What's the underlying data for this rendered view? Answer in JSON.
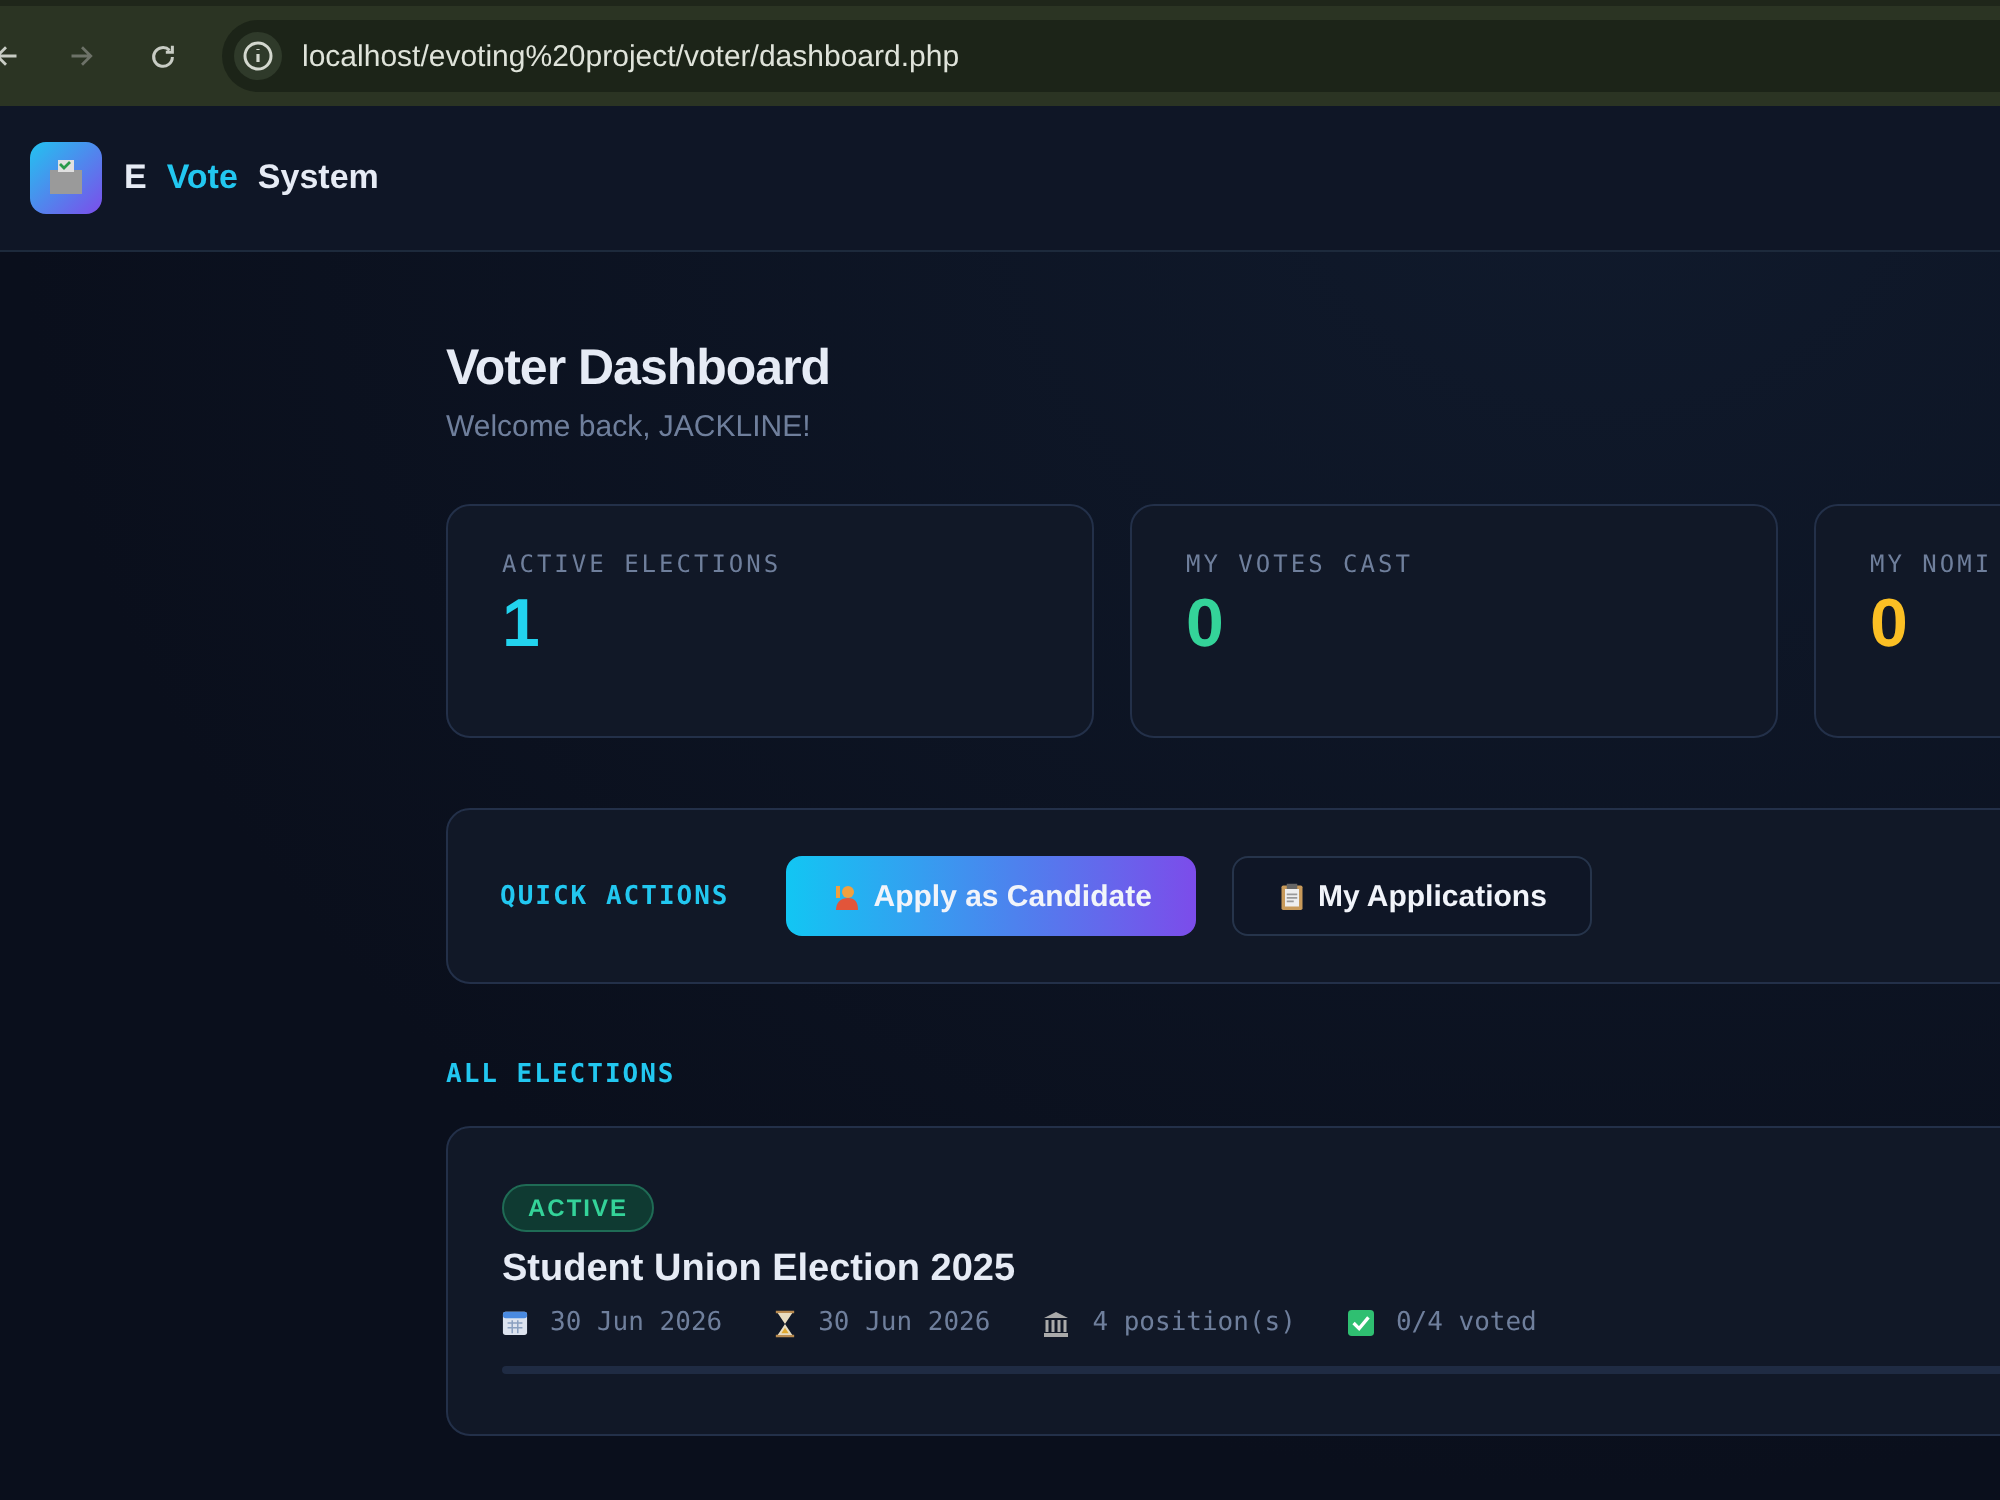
{
  "browser": {
    "url": "localhost/evoting%20project/voter/dashboard.php"
  },
  "brand": {
    "prefix": "E",
    "highlight": "Vote",
    "suffix": "System"
  },
  "page": {
    "title": "Voter Dashboard",
    "subtitle": "Welcome back, JACKLINE!"
  },
  "stats": [
    {
      "label": "ACTIVE ELECTIONS",
      "value": "1",
      "color": "#22d3ee"
    },
    {
      "label": "MY VOTES CAST",
      "value": "0",
      "color": "#34d399"
    },
    {
      "label": "MY NOMI",
      "value": "0",
      "color": "#fbbf24"
    }
  ],
  "quick_actions": {
    "label": "QUICK ACTIONS",
    "buttons": [
      {
        "label": "Apply as Candidate",
        "kind": "primary"
      },
      {
        "label": "My Applications",
        "kind": "secondary"
      }
    ]
  },
  "elections_heading": "ALL ELECTIONS",
  "elections": [
    {
      "status": {
        "label": "ACTIVE",
        "kind": "active"
      },
      "title": "Student Union Election 2025",
      "meta": [
        {
          "kind": "start",
          "text": "30 Jun 2026"
        },
        {
          "kind": "end",
          "text": "30 Jun 2026"
        },
        {
          "kind": "positions",
          "text": "4 position(s)"
        },
        {
          "kind": "voted",
          "text": "0/4 voted"
        }
      ],
      "level": 0
    }
  ]
}
